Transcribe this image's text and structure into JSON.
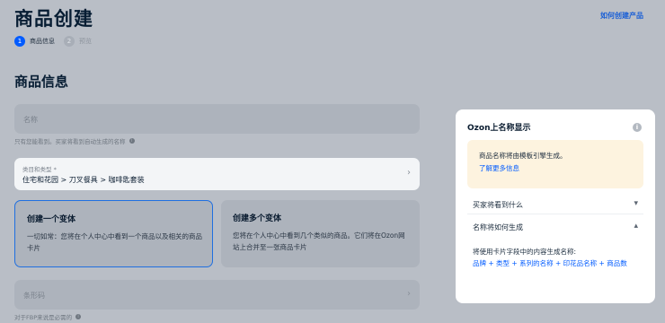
{
  "header": {
    "title": "商品创建",
    "help_link": "如何创建产品"
  },
  "steps": [
    {
      "num": "1",
      "label": "商品信息"
    },
    {
      "num": "2",
      "label": "预览"
    }
  ],
  "section": {
    "title": "商品信息"
  },
  "name_field": {
    "placeholder": "名称",
    "hint": "只有您能看到。买家将看到自动生成的名称",
    "info_icon": "info-icon"
  },
  "category_field": {
    "label": "类目和类型 *",
    "value": "住宅和花园 > 刀叉餐具 > 咖啡匙套装",
    "chevron": "chevron-right-icon"
  },
  "variants": [
    {
      "title": "创建一个变体",
      "desc": "一切如常：您将在个人中心中看到一个商品以及相关的商品卡片",
      "selected": true
    },
    {
      "title": "创建多个变体",
      "desc": "您将在个人中心中看到几个类似的商品。它们将在Ozon网站上合并至一张商品卡片",
      "selected": false
    }
  ],
  "barcode_field": {
    "placeholder": "条形码",
    "hint": "对于FBP来说是必需的",
    "info_icon": "info-icon"
  },
  "side_panel": {
    "title": "Ozon上名称显示",
    "info_icon": "info-icon",
    "notice_text": "商品名称将由模板引擎生成。",
    "notice_link": "了解更多信息",
    "accordion": [
      {
        "label": "买家将看到什么",
        "chevron": "▾"
      },
      {
        "label": "名称将如何生成",
        "chevron": "▴"
      }
    ],
    "template_intro": "将使用卡片字段中的内容生成名称:",
    "template_formula": "品牌 + 类型 + 系列的名称 + 印花品名称 + 商品数"
  },
  "colors": {
    "accent": "#005bff",
    "overlay_bg": "#b9bec6",
    "notice_bg": "#fdf3df"
  }
}
